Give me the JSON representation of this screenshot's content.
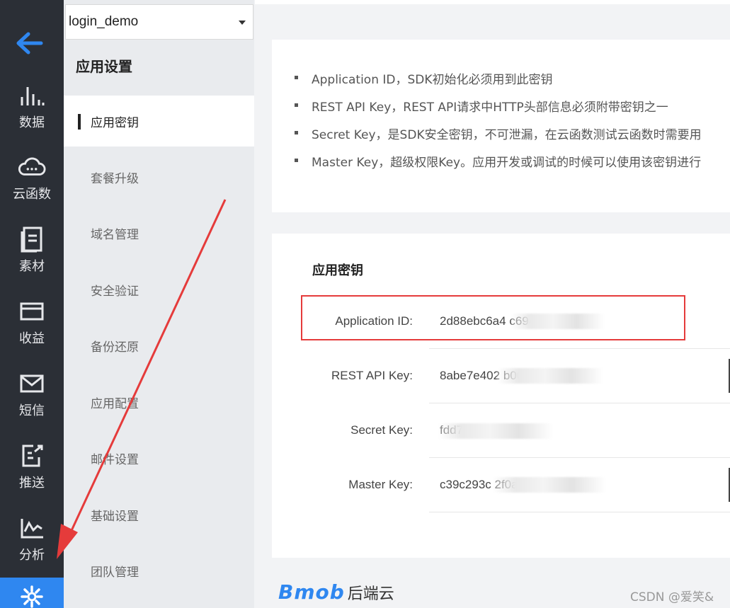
{
  "rail": {
    "items": [
      {
        "label": "数据"
      },
      {
        "label": "云函数"
      },
      {
        "label": "素材"
      },
      {
        "label": "收益"
      },
      {
        "label": "短信"
      },
      {
        "label": "推送"
      },
      {
        "label": "分析"
      },
      {
        "label": ""
      }
    ]
  },
  "app_select": {
    "value": "login_demo"
  },
  "sidebar": {
    "title": "应用设置",
    "items": [
      {
        "label": "应用密钥"
      },
      {
        "label": "套餐升级"
      },
      {
        "label": "域名管理"
      },
      {
        "label": "安全验证"
      },
      {
        "label": "备份还原"
      },
      {
        "label": "应用配置"
      },
      {
        "label": "邮件设置"
      },
      {
        "label": "基础设置"
      },
      {
        "label": "团队管理"
      }
    ]
  },
  "notes": [
    "Application ID，SDK初始化必须用到此密钥",
    "REST API Key，REST API请求中HTTP头部信息必须附带密钥之一",
    "Secret Key，是SDK安全密钥，不可泄漏，在云函数测试云函数时需要用",
    "Master Key，超级权限Key。应用开发或调试的时候可以使用该密钥进行"
  ],
  "keys": {
    "title": "应用密钥",
    "rows": [
      {
        "label": "Application ID:",
        "value": "2d88ebc6a4                c694e0e0"
      },
      {
        "label": "REST API Key:",
        "value": "8abe7e402                  b0093f35"
      },
      {
        "label": "Secret Key:",
        "value": "fdd7459d"
      },
      {
        "label": "Master Key:",
        "value": "c39c293c                 2f0a2395"
      }
    ]
  },
  "footer": {
    "brand": "Bmob",
    "brand_suffix": "后端云",
    "watermark": "CSDN @爱笑&"
  },
  "colors": {
    "rail_bg": "#2b2f36",
    "accent": "#2f87f0",
    "highlight": "#e53b3b",
    "arrow": "#e53b3b"
  }
}
